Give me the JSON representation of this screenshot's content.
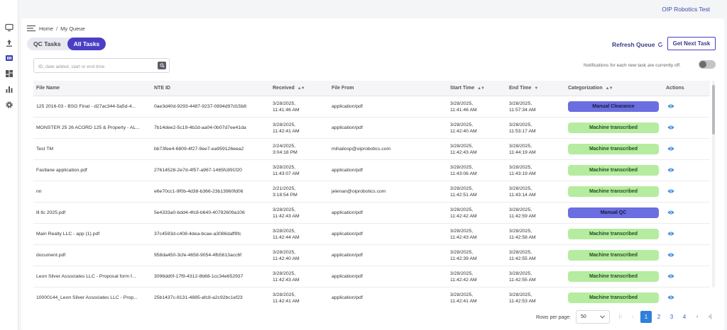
{
  "org_name": "OIP Robotics Test",
  "sidebar": {
    "icons": [
      "monitor-icon",
      "upload-icon",
      "queue-icon",
      "dashboard-icon",
      "bar-chart-icon",
      "gear-icon"
    ]
  },
  "breadcrumb": {
    "home": "Home",
    "separator": "/",
    "current": "My Queue"
  },
  "tabs": [
    {
      "label": "QC Tasks",
      "active": false
    },
    {
      "label": "All Tasks",
      "active": true
    }
  ],
  "toolbar": {
    "refresh_label": "Refresh Queue",
    "next_task_label": "Get Next Task"
  },
  "search": {
    "placeholder": "ID, date added, start or end time",
    "value": ""
  },
  "notifications": {
    "text": "Notifications for each new task are currently off.",
    "enabled": false
  },
  "table": {
    "columns": [
      {
        "label": "File Name",
        "sortable": false
      },
      {
        "label": "NTE ID",
        "sortable": false
      },
      {
        "label": "Received",
        "sortable": true,
        "sort": "both"
      },
      {
        "label": "File From",
        "sortable": false
      },
      {
        "label": "Start Time",
        "sortable": true,
        "sort": "both"
      },
      {
        "label": "End Time",
        "sortable": true,
        "sort": "desc"
      },
      {
        "label": "Categorization",
        "sortable": true,
        "sort": "both"
      },
      {
        "label": "Actions",
        "sortable": false
      }
    ],
    "rows": [
      {
        "file_name": "125 2016-03 - BSG Final - d27ac344-5a5d-4...",
        "nte_id": "0ae3d40d-9293-4487-9237-0894d97d15b8",
        "received_date": "3/28/2025,",
        "received_time": "11:41:46 AM",
        "file_from": "application/pdf",
        "start_date": "3/28/2025,",
        "start_time": "11:41:46 AM",
        "end_date": "3/28/2025,",
        "end_time": "11:57:34 AM",
        "categorization": "Manual Clearance",
        "cat_type": "mc"
      },
      {
        "file_name": "MONSTER 25 26 ACORD 125 & Property - AL...",
        "nte_id": "7b14dee2-5c19-4b2d-aa04-0b07d7ee41da",
        "received_date": "3/28/2025,",
        "received_time": "11:42:41 AM",
        "file_from": "application/pdf",
        "start_date": "3/28/2025,",
        "start_time": "11:42:40 AM",
        "end_date": "3/28/2025,",
        "end_time": "11:53:17 AM",
        "categorization": "Machine transcribed",
        "cat_type": "mt"
      },
      {
        "file_name": "Test TM",
        "nte_id": "bb73fee4-6809-4f27-9ee7-ea959126eea2",
        "received_date": "2/24/2025,",
        "received_time": "3:04:18 PM",
        "file_from": "mihailosp@oiprobotics.com",
        "start_date": "3/28/2025,",
        "start_time": "11:42:43 AM",
        "end_date": "3/28/2025,",
        "end_time": "11:44:19 AM",
        "categorization": "Machine transcribed",
        "cat_type": "mt"
      },
      {
        "file_name": "Fastlane application.pdf",
        "nte_id": "27614528-2e7d-4f57-a967-1465fc891f20",
        "received_date": "3/28/2025,",
        "received_time": "11:43:07 AM",
        "file_from": "application/pdf",
        "start_date": "3/28/2025,",
        "start_time": "11:43:06 AM",
        "end_date": "3/28/2025,",
        "end_time": "11:43:19 AM",
        "categorization": "Machine transcribed",
        "cat_type": "mt"
      },
      {
        "file_name": "nn",
        "nte_id": "e6e70cc1-9f0b-4d38-b366-23b13960fd06",
        "received_date": "2/21/2025,",
        "received_time": "3:18:54 PM",
        "file_from": "jelenan@oiprobotics.com",
        "start_date": "3/28/2025,",
        "start_time": "11:42:51 AM",
        "end_date": "3/28/2025,",
        "end_time": "11:43:14 AM",
        "categorization": "Machine transcribed",
        "cat_type": "mt"
      },
      {
        "file_name": "lll llc 2025.pdf",
        "nte_id": "5e4333a0-bdd4-4fc8-b640-40782609a106",
        "received_date": "3/28/2025,",
        "received_time": "11:42:43 AM",
        "file_from": "application/pdf",
        "start_date": "3/28/2025,",
        "start_time": "11:42:42 AM",
        "end_date": "3/28/2025,",
        "end_time": "11:42:59 AM",
        "categorization": "Manual QC",
        "cat_type": "mc"
      },
      {
        "file_name": "Main Realty LLC - app (1).pdf",
        "nte_id": "37c4593d-c408-4dea-bcae-a3086daff9fc",
        "received_date": "3/28/2025,",
        "received_time": "11:42:44 AM",
        "file_from": "application/pdf",
        "start_date": "3/28/2025,",
        "start_time": "11:42:43 AM",
        "end_date": "3/28/2025,",
        "end_time": "11:42:58 AM",
        "categorization": "Machine transcribed",
        "cat_type": "mt"
      },
      {
        "file_name": "document.pdf",
        "nte_id": "958da450-3cfe-4658-9054-4fb5613acc6f",
        "received_date": "3/28/2025,",
        "received_time": "11:42:40 AM",
        "file_from": "application/pdf",
        "start_date": "3/28/2025,",
        "start_time": "11:42:39 AM",
        "end_date": "3/28/2025,",
        "end_time": "11:42:55 AM",
        "categorization": "Machine transcribed",
        "cat_type": "mt"
      },
      {
        "file_name": "Leon Silver Associates LLC - Proposal form f...",
        "nte_id": "3096dd0f-17f9-4312-8b68-1cc34e652937",
        "received_date": "3/28/2025,",
        "received_time": "11:42:43 AM",
        "file_from": "application/pdf",
        "start_date": "3/28/2025,",
        "start_time": "11:42:42 AM",
        "end_date": "3/28/2025,",
        "end_time": "11:42:55 AM",
        "categorization": "Machine transcribed",
        "cat_type": "mt"
      },
      {
        "file_name": "10000144_Leon Silver Associates LLC - Prop...",
        "nte_id": "25b1437c-8131-4885-afc8-a2c92bc1ef23",
        "received_date": "3/28/2025,",
        "received_time": "11:42:41 AM",
        "file_from": "application/pdf",
        "start_date": "3/28/2025,",
        "start_time": "11:42:41 AM",
        "end_date": "3/28/2025,",
        "end_time": "11:42:53 AM",
        "categorization": "Machine transcribed",
        "cat_type": "mt"
      }
    ]
  },
  "pagination": {
    "rows_per_page_label": "Rows per page:",
    "rows_per_page": "50",
    "pages": [
      "1",
      "2",
      "3",
      "4"
    ],
    "current_page": "1",
    "first": "|‹",
    "prev": "‹",
    "next": "›",
    "last": "›|"
  },
  "colors": {
    "accent": "#4a3fc4",
    "machine_transcribed": "#b5eca0",
    "manual": "#6b6ee0",
    "eye_icon": "#2f80d9",
    "page_active": "#2f80d9"
  }
}
